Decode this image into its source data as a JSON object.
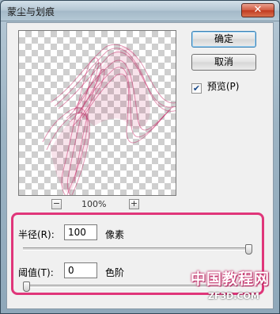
{
  "window": {
    "title": "蒙尘与划痕",
    "close_glyph": "✕"
  },
  "buttons": {
    "ok_label": "确定",
    "cancel_label": "取消"
  },
  "preview_toggle": {
    "label": "预览(P)",
    "checked": true,
    "check_glyph": "✔"
  },
  "zoom": {
    "minus_glyph": "−",
    "plus_glyph": "+",
    "level": "100%"
  },
  "radius": {
    "label": "半径(R):",
    "value": "100",
    "unit": "像素",
    "slider_fraction": 1.0
  },
  "threshold": {
    "label": "阈值(T):",
    "value": "0",
    "unit": "色阶",
    "slider_fraction": 0.0
  },
  "watermark": {
    "text": "中国教程网",
    "url": "ZF3D.COM"
  },
  "colors": {
    "highlight": "#e0367a",
    "ribbon": "#c2185b"
  }
}
